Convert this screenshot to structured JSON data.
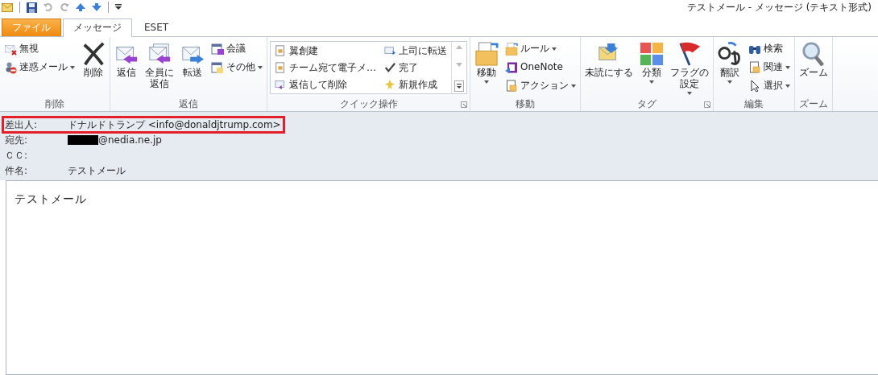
{
  "window": {
    "title": "テストメール  -  メッセージ (テキスト形式)"
  },
  "tabs": [
    {
      "label": "ファイル",
      "kind": "file",
      "selected": false
    },
    {
      "label": "メッセージ",
      "kind": "tab",
      "selected": true
    },
    {
      "label": "ESET",
      "kind": "tab",
      "selected": false
    }
  ],
  "ribbon": {
    "groups": [
      {
        "label": "削除",
        "kind": "buttons",
        "launcher": false,
        "columns": [
          [
            {
              "lines": [
                "無視"
              ],
              "kind": "small",
              "dropdown": false
            },
            {
              "lines": [
                "迷惑メール"
              ],
              "kind": "small",
              "dropdown": true
            }
          ],
          [
            {
              "lines": [
                "削除"
              ],
              "kind": "large",
              "dropdown": false
            }
          ]
        ]
      },
      {
        "label": "返信",
        "kind": "buttons",
        "launcher": false,
        "columns": [
          [
            {
              "lines": [
                "返信"
              ],
              "kind": "large",
              "dropdown": false
            }
          ],
          [
            {
              "lines": [
                "全員に",
                "返信"
              ],
              "kind": "large",
              "dropdown": false
            }
          ],
          [
            {
              "lines": [
                "転送"
              ],
              "kind": "large",
              "dropdown": false
            }
          ],
          [
            {
              "lines": [
                "会議"
              ],
              "kind": "small",
              "dropdown": false
            },
            {
              "lines": [
                "その他"
              ],
              "kind": "small",
              "dropdown": true
            }
          ]
        ]
      },
      {
        "label": "クイック操作",
        "kind": "gallery",
        "launcher": true,
        "columns": [
          [
            {
              "lines": [
                "翼創建"
              ]
            },
            {
              "lines": [
                "チーム宛て電子メ…"
              ]
            },
            {
              "lines": [
                "返信して削除"
              ]
            }
          ],
          [
            {
              "lines": [
                "上司に転送"
              ]
            },
            {
              "lines": [
                "完了"
              ]
            },
            {
              "lines": [
                "新規作成"
              ]
            }
          ]
        ]
      },
      {
        "label": "移動",
        "kind": "buttons",
        "launcher": false,
        "columns": [
          [
            {
              "lines": [
                "移動"
              ],
              "kind": "large",
              "dropdown": true
            }
          ],
          [
            {
              "lines": [
                "ルール"
              ],
              "kind": "small",
              "dropdown": true
            },
            {
              "lines": [
                "OneNote"
              ],
              "kind": "small",
              "dropdown": false
            },
            {
              "lines": [
                "アクション"
              ],
              "kind": "small",
              "dropdown": true
            }
          ]
        ]
      },
      {
        "label": "タグ",
        "kind": "buttons",
        "launcher": true,
        "columns": [
          [
            {
              "lines": [
                "未読にする"
              ],
              "kind": "large",
              "dropdown": false
            }
          ],
          [
            {
              "lines": [
                "分類"
              ],
              "kind": "large",
              "dropdown": true
            }
          ],
          [
            {
              "lines": [
                "フラグの",
                "設定"
              ],
              "kind": "large",
              "dropdown": true
            }
          ]
        ]
      },
      {
        "label": "編集",
        "kind": "buttons",
        "launcher": false,
        "columns": [
          [
            {
              "lines": [
                "翻訳"
              ],
              "kind": "large",
              "dropdown": true
            }
          ],
          [
            {
              "lines": [
                "検索"
              ],
              "kind": "small",
              "dropdown": false
            },
            {
              "lines": [
                "関連"
              ],
              "kind": "small",
              "dropdown": true
            },
            {
              "lines": [
                "選択"
              ],
              "kind": "small",
              "dropdown": true
            }
          ]
        ]
      },
      {
        "label": "ズーム",
        "kind": "buttons",
        "launcher": false,
        "columns": [
          [
            {
              "lines": [
                "ズーム"
              ],
              "kind": "large",
              "dropdown": false
            }
          ]
        ]
      }
    ]
  },
  "headers": [
    {
      "label": "差出人:",
      "value": "ドナルドトランプ <info@donaldjtrump.com>",
      "highlighted": true,
      "redacted": false
    },
    {
      "label": "宛先:",
      "value": "@nedia.ne.jp",
      "highlighted": false,
      "redacted": true
    },
    {
      "label": "ＣＣ:",
      "highlighted": false,
      "redacted": false
    },
    {
      "label": "件名:",
      "value": "テストメール",
      "highlighted": false,
      "redacted": false
    }
  ],
  "body": {
    "text": "テストメール"
  }
}
